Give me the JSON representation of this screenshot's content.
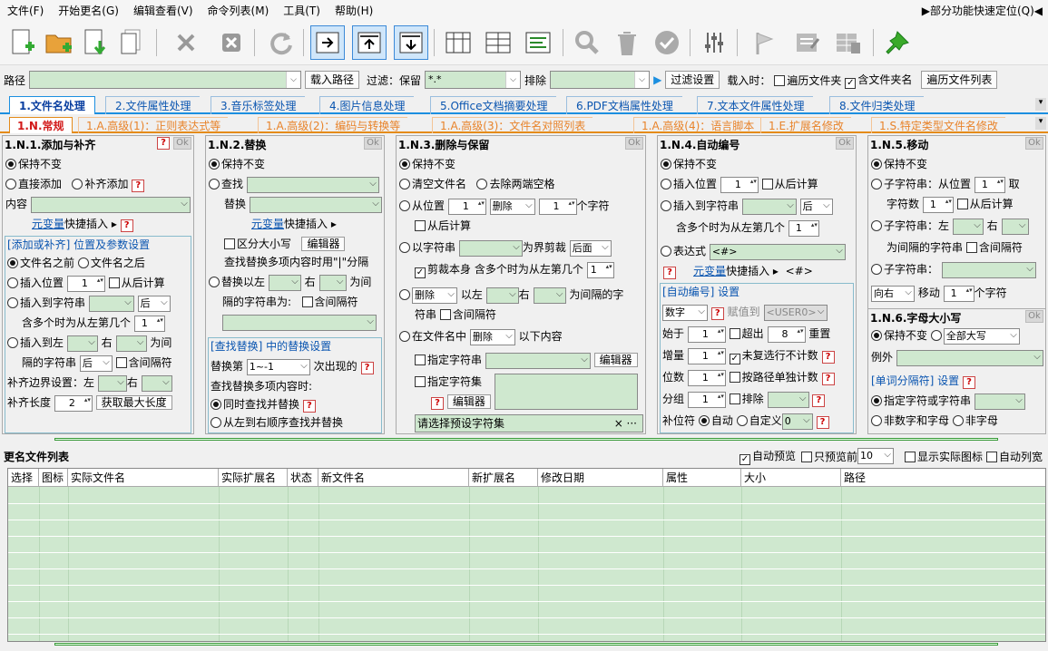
{
  "menu": {
    "file": "文件(F)",
    "rename": "开始更名(G)",
    "edit": "编辑查看(V)",
    "cmds": "命令列表(M)",
    "tools": "工具(T)",
    "help": "帮助(H)",
    "quick": "▶部分功能快速定位(Q)◀"
  },
  "pathbar": {
    "path_label": "路径",
    "load_btn": "载入路径",
    "filter_label": "过滤：保留",
    "filter_value": "*.*",
    "exclude_label": "排除",
    "filter_btn": "过滤设置",
    "load_label": "载入时：",
    "subfolders": "遍历文件夹",
    "include_folder": "含文件夹名",
    "list_btn": "遍历文件列表"
  },
  "tabs": [
    "1.文件名处理",
    "2.文件属性处理",
    "3.音乐标签处理",
    "4.图片信息处理",
    "5.Office文档摘要处理",
    "6.PDF文档属性处理",
    "7.文本文件属性处理",
    "8.文件归类处理"
  ],
  "subtabs": [
    "1.N.常规",
    "1.A.高级(1)：正则表达式等",
    "1.A.高级(2)：编码与转换等",
    "1.A.高级(3)：文件名对照列表",
    "1.A.高级(4)：语言脚本",
    "1.E.扩展名修改",
    "1.S.特定类型文件名修改"
  ],
  "p1": {
    "title": "1.N.1.添加与补齐",
    "ok": "Ok",
    "keep": "保持不变",
    "direct": "直接添加",
    "pad": "补齐添加",
    "content": "内容",
    "metavar": "元变量",
    "quick": "快捷插入 ▸",
    "settings": "[添加或补齐] 位置及参数设置",
    "before": "文件名之前",
    "after": "文件名之后",
    "insert_pos": "插入位置",
    "pos_val": "1",
    "from_end": "从后计算",
    "insert_str": "插入到字符串",
    "back": "后",
    "multi": "含多个时为从左第几个",
    "multi_val": "1",
    "insert_lr": "插入到左",
    "right": "右",
    "between": "为间",
    "gap_str": "隔的字符串",
    "back2": "后",
    "include_gap": "含间隔符",
    "pad_set": "补齐边界设置：左",
    "right2": "右",
    "pad_len": "补齐长度",
    "pad_len_val": "2",
    "max_len": "获取最大长度"
  },
  "p2": {
    "title": "1.N.2.替换",
    "ok": "Ok",
    "keep": "保持不变",
    "find": "查找",
    "replace": "替换",
    "metavar": "元变量",
    "quick": "快捷插入 ▸",
    "case": "区分大小写",
    "editor": "编辑器",
    "multi_note": "查找替换多项内容时用\"|\"分隔",
    "replace_lr": "替换以左",
    "right": "右",
    "between": "为间",
    "gap_str": "隔的字符串为:",
    "include_gap": "含间隔符",
    "settings": "[查找替换] 中的替换设置",
    "replace_nth": "替换第",
    "nth_val": "1~-1",
    "nth_suffix": "次出现的",
    "multi_when": "查找替换多项内容时:",
    "simul": "同时查找并替换",
    "seq": "从左到右顺序查找并替换"
  },
  "p3": {
    "title": "1.N.3.删除与保留",
    "ok": "Ok",
    "keep": "保持不变",
    "clear": "清空文件名",
    "trim": "去除两端空格",
    "from_pos": "从位置",
    "from_val": "1",
    "delete": "删除",
    "count_val": "1",
    "chars": "个字符",
    "from_end": "从后计算",
    "by_str": "以字符串",
    "boundary": "为界剪裁",
    "back": "后面",
    "cut_self": "剪裁本身",
    "multi": "含多个时为从左第几个",
    "multi_val": "1",
    "delete2": "删除",
    "left": "以左",
    "right": "右",
    "gap": "为间隔的字",
    "gap2": "符串",
    "include_gap": "含间隔符",
    "in_name": "在文件名中",
    "delete3": "删除",
    "below": "以下内容",
    "spec_str": "指定字符串",
    "editor": "编辑器",
    "spec_set": "指定字符集",
    "editor2": "编辑器",
    "preset": "请选择预设字符集",
    "preset_icons": "× ···"
  },
  "p4": {
    "title": "1.N.4.自动编号",
    "ok": "Ok",
    "keep": "保持不变",
    "insert_pos": "插入位置",
    "pos_val": "1",
    "from_end": "从后计算",
    "insert_str": "插入到字符串",
    "back": "后",
    "multi": "含多个时为从左第几个",
    "multi_val": "1",
    "expr": "表达式",
    "expr_val": "<#>",
    "metavar": "元变量",
    "quick": "快捷插入 ▸",
    "expr_hint": "<#>",
    "settings": "[自动编号] 设置",
    "numtype": "数字",
    "assign": "赋值到",
    "userval": "<USER0>",
    "start": "始于",
    "start_val": "1",
    "overflow": "超出",
    "overflow_val": "8",
    "reset": "重置",
    "step": "增量",
    "step_val": "1",
    "no_repeat": "未复选行不计数",
    "digits": "位数",
    "digits_val": "1",
    "by_path": "按路径单独计数",
    "group": "分组",
    "group_val": "1",
    "exclude": "排除",
    "pad_char": "补位符",
    "auto": "自动",
    "custom": "自定义",
    "custom_val": "0"
  },
  "p5": {
    "title": "1.N.5.移动",
    "ok": "Ok",
    "keep": "保持不变",
    "sub_from": "子字符串：从位置",
    "sub_from_val": "1",
    "take": "取",
    "char_count": "字符数",
    "char_count_val": "1",
    "from_end": "从后计算",
    "sub_left": "子字符串：左",
    "right": "右",
    "gap_str": "为间隔的字符串",
    "include_gap": "含间隔符",
    "sub": "子字符串：",
    "dir": "向右",
    "move": "移动",
    "move_val": "1",
    "chars": "个字符",
    "case_title": "1.N.6.字母大小写",
    "case_ok": "Ok",
    "case_keep": "保持不变",
    "case_val": "全部大写",
    "except": "例外",
    "sep_settings": "[单词分隔符] 设置",
    "sep_spec": "指定字符或字符串",
    "non_alnum": "非数字和字母",
    "non_letter": "非字母"
  },
  "list": {
    "title": "更名文件列表",
    "auto_preview": "自动预览",
    "only_first": "只预览前",
    "first_val": "10",
    "real_icon": "显示实际图标",
    "auto_width": "自动列宽",
    "cols": [
      "选择",
      "图标",
      "实际文件名",
      "实际扩展名",
      "状态",
      "新文件名",
      "新扩展名",
      "修改日期",
      "属性",
      "大小",
      "路径"
    ]
  }
}
